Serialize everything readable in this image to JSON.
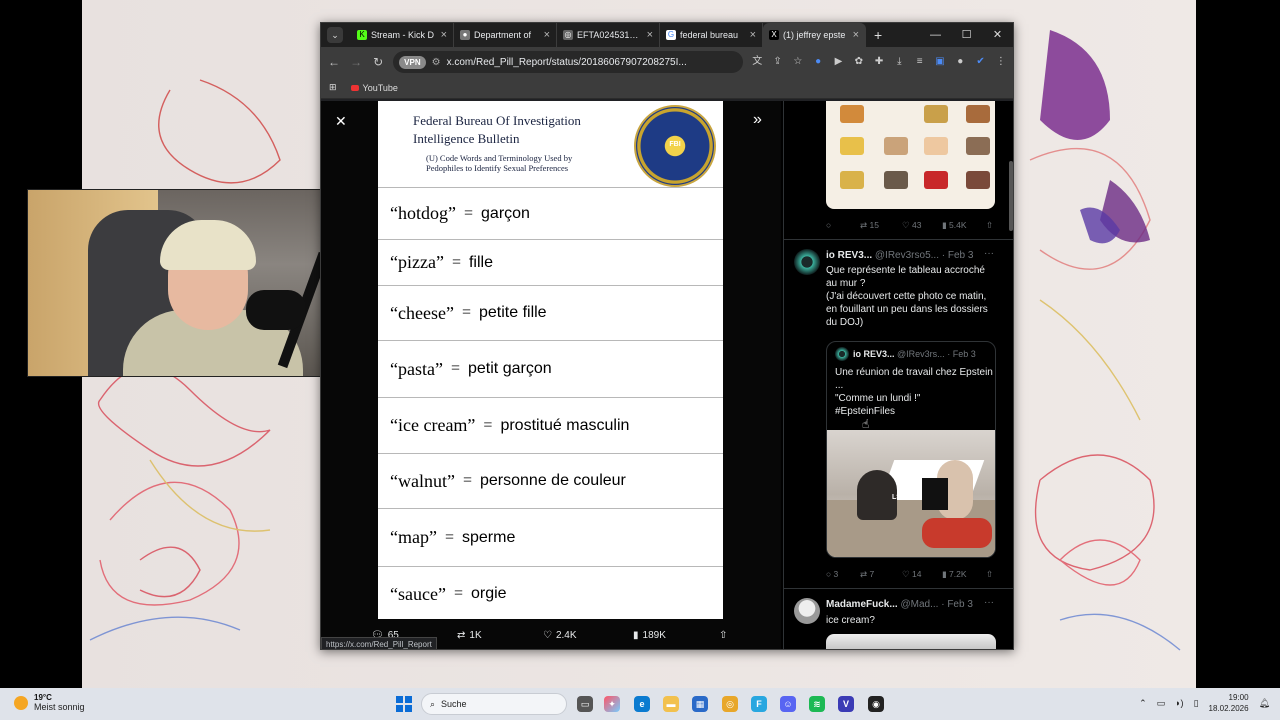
{
  "browser": {
    "tabs": [
      {
        "label": "Stream - Kick D",
        "favicon": "kick-icon",
        "color": "#53fc18",
        "active": false
      },
      {
        "label": "Department of",
        "favicon": "doj-icon",
        "color": "#8a8a8a",
        "active": false
      },
      {
        "label": "EFTA02453157.p",
        "favicon": "globe-icon",
        "color": "#8a8a8a",
        "active": false
      },
      {
        "label": "federal bureau",
        "favicon": "google-icon",
        "color": "#4285f4",
        "active": false
      },
      {
        "label": "(1) jeffrey epste",
        "favicon": "x-icon",
        "color": "#000000",
        "active": true
      }
    ],
    "new_tab": "+",
    "url": "x.com/Red_Pill_Report/status/20186067907208275I...",
    "vpn_label": "VPN",
    "bookmark": "YouTube",
    "status_url": "https://x.com/Red_Pill_Report"
  },
  "bulletin": {
    "title_line1": "Federal Bureau Of Investigation",
    "title_line2": "Intelligence Bulletin",
    "subtitle": "(U) Code Words and Terminology Used by Pedophiles to Identify Sexual Preferences",
    "seal_text": "FBI",
    "rows": [
      {
        "term": "“hotdog”",
        "meaning": "garçon"
      },
      {
        "term": "“pizza”",
        "meaning": "fille"
      },
      {
        "term": "“cheese”",
        "meaning": "petite fille"
      },
      {
        "term": "“pasta”",
        "meaning": "petit garçon"
      },
      {
        "term": "“ice cream”",
        "meaning": "prostitué masculin"
      },
      {
        "term": "“walnut”",
        "meaning": "personne de couleur"
      },
      {
        "term": "“map”",
        "meaning": "sperme"
      },
      {
        "term": "“sauce”",
        "meaning": "orgie"
      }
    ]
  },
  "post_actions": {
    "replies": "65",
    "reposts": "1K",
    "likes": "2.4K",
    "views": "189K"
  },
  "feed": {
    "tweet1_actions": {
      "reposts": "15",
      "likes": "43",
      "views": "5.4K"
    },
    "tweet2": {
      "name": "io REV3...",
      "handle": "@IRev3rso5...",
      "date": "· Feb 3",
      "text": "Que représente le tableau accroché au mur ?\n(J'ai découvert cette photo ce matin, en fouillant un peu dans les dossiers du DOJ)",
      "quote": {
        "name": "io REV3...",
        "handle": "@IRev3rs...",
        "date": "· Feb 3",
        "text": "Une réunion de travail chez Epstein ...\n\"Comme un lundi !\"\n#EpsteinFiles",
        "image_label": "LSJ"
      },
      "actions": {
        "replies": "3",
        "reposts": "7",
        "likes": "14",
        "views": "7.2K"
      }
    },
    "tweet3": {
      "name": "MadameFuck...",
      "handle": "@Mad...",
      "date": "· Feb 3",
      "text": "ice cream?"
    }
  },
  "taskbar": {
    "temperature": "19°C",
    "weather": "Meist sonnig",
    "search": "Suche",
    "time": "19:00",
    "date": "18.02.2026"
  }
}
